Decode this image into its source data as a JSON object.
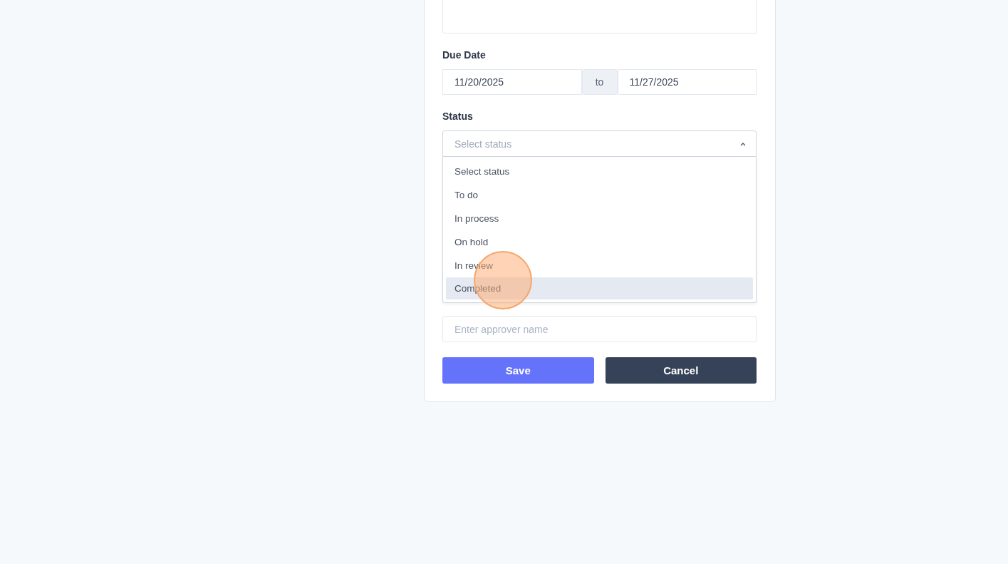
{
  "form": {
    "fields": [
      {
        "kind": "textarea"
      },
      {
        "kind": "daterange",
        "label": "Due Date",
        "from": "11/20/2025",
        "separator": "to",
        "to": "11/27/2025"
      },
      {
        "kind": "select",
        "label": "Status",
        "placeholder": "Select status",
        "expanded": true,
        "options": [
          {
            "label": "Select status",
            "selected": false
          },
          {
            "label": "To do",
            "selected": false
          },
          {
            "label": "In process",
            "selected": false
          },
          {
            "label": "On hold",
            "selected": false
          },
          {
            "label": "In review",
            "selected": false
          },
          {
            "label": "Completed",
            "selected": true
          }
        ]
      },
      {
        "kind": "text",
        "placeholder": "Enter approver name"
      }
    ],
    "buttons": [
      {
        "label": "Save",
        "kind": "primary"
      },
      {
        "label": "Cancel",
        "kind": "secondary"
      }
    ]
  },
  "cursor": {
    "kind": "click"
  }
}
